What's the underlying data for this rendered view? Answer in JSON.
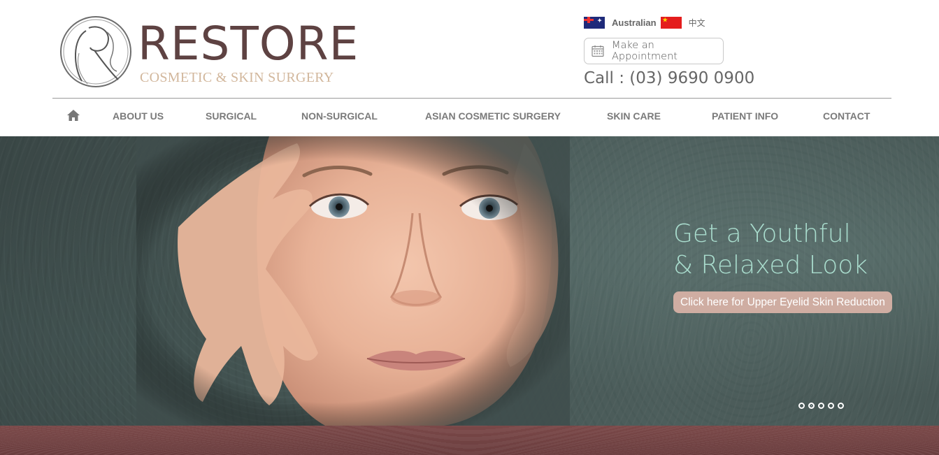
{
  "brand": {
    "logo_letter": "R",
    "wordmark": "RESTORE",
    "tagline": "COSMETIC & SKIN SURGERY",
    "colors": {
      "wordmark": "#5e4242",
      "tagline": "#d2b79c"
    }
  },
  "languages": [
    {
      "label": "Australian",
      "flag": "australia-flag-icon"
    },
    {
      "label": "中文",
      "flag": "china-flag-icon"
    }
  ],
  "appointment": {
    "label": "Make an Appointment",
    "icon": "calendar-icon"
  },
  "call": {
    "text": "Call : (03) 9690 0900"
  },
  "nav": {
    "home_icon": "home-icon",
    "items": [
      {
        "label": "ABOUT US"
      },
      {
        "label": "SURGICAL"
      },
      {
        "label": "NON-SURGICAL"
      },
      {
        "label": "ASIAN COSMETIC SURGERY"
      },
      {
        "label": "SKIN CARE"
      },
      {
        "label": "PATIENT INFO"
      },
      {
        "label": "CONTACT"
      }
    ]
  },
  "hero": {
    "headline_line1": "Get a Youthful",
    "headline_line2": "& Relaxed Look",
    "cta_label": "Click here for Upper Eyelid Skin Reduction",
    "slides_total": 5,
    "active_slide": 2,
    "colors": {
      "headline": "#a9dccd",
      "cta_bg": "#cfada2",
      "band": "#6a3d3e"
    }
  }
}
